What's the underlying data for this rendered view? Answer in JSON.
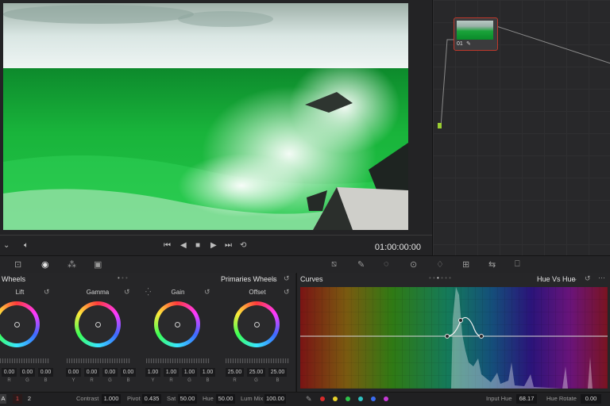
{
  "viewer": {
    "timecode": "01:00:00:00",
    "icons": [
      "speaker-icon",
      "skip-back-icon",
      "play-reverse-icon",
      "stop-icon",
      "play-icon",
      "skip-forward-icon",
      "loop-icon"
    ]
  },
  "node": {
    "label": "01"
  },
  "toolbar": {
    "icons": [
      "frame-icon",
      "color-wheel-icon",
      "nodes-icon",
      "rgb-mixer-icon",
      "curves-icon",
      "qualifier-icon",
      "window-icon",
      "tracker-icon",
      "blur-icon",
      "key-icon",
      "sizing-icon",
      "3d-icon"
    ]
  },
  "wheels": {
    "title": "Wheels",
    "mode": "Primaries Wheels",
    "items": [
      {
        "label": "Lift",
        "values": [
          "0.00",
          "0.00",
          "0.00"
        ],
        "channels": [
          "R",
          "G",
          "B"
        ]
      },
      {
        "label": "Gamma",
        "values": [
          "0.00",
          "0.00",
          "0.00",
          "0.00"
        ],
        "channels": [
          "Y",
          "R",
          "G",
          "B"
        ]
      },
      {
        "label": "Gain",
        "values": [
          "1.00",
          "1.00",
          "1.00",
          "1.00"
        ],
        "channels": [
          "Y",
          "R",
          "G",
          "B"
        ]
      },
      {
        "label": "Offset",
        "values": [
          "25.00",
          "25.00",
          "25.00"
        ],
        "channels": [
          "R",
          "G",
          "B"
        ]
      }
    ]
  },
  "curves": {
    "title": "Curves",
    "mode": "Hue Vs Hue"
  },
  "bottom": {
    "pages": [
      "A",
      "1",
      "2"
    ],
    "contrast_label": "Contrast",
    "contrast_value": "1.000",
    "pivot_label": "Pivot",
    "pivot_value": "0.435",
    "sat_label": "Sat",
    "sat_value": "50.00",
    "hue_label": "Hue",
    "hue_value": "50.00",
    "lummix_label": "Lum Mix",
    "lummix_value": "100.00",
    "input_hue_label": "Input Hue",
    "input_hue_value": "68.17",
    "hue_rotate_label": "Hue Rotate",
    "hue_rotate_value": "0.00",
    "swatch_colors": [
      "#d62b2b",
      "#e8d12a",
      "#2fc24a",
      "#2fc2c2",
      "#3b6cf0",
      "#c63bd6"
    ]
  }
}
